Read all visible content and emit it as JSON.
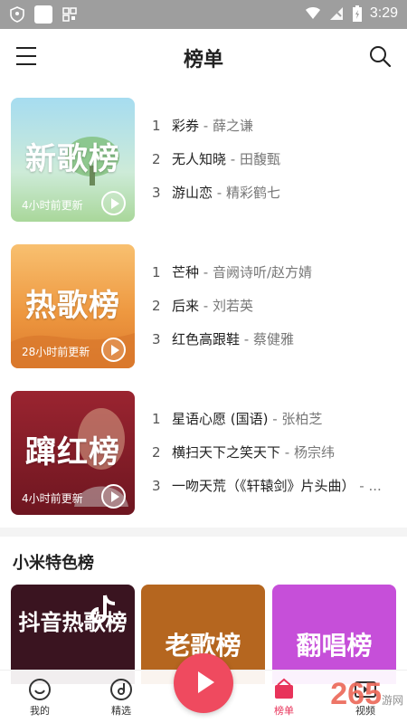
{
  "status_bar": {
    "time": "3:29"
  },
  "header": {
    "title": "榜单"
  },
  "ranks": [
    {
      "cover_title": "新歌榜",
      "update_text": "4小时前更新",
      "colors": {
        "top": "#9fd6e8",
        "bottom": "#b9e3c8"
      },
      "songs": [
        {
          "num": "1",
          "name": "彩券",
          "artist": " - 薛之谦"
        },
        {
          "num": "2",
          "name": "无人知晓",
          "artist": " - 田馥甄"
        },
        {
          "num": "3",
          "name": "游山恋",
          "artist": " - 精彩鹤七"
        }
      ]
    },
    {
      "cover_title": "热歌榜",
      "update_text": "28小时前更新",
      "colors": {
        "top": "#f6b15d",
        "bottom": "#e8873a"
      },
      "songs": [
        {
          "num": "1",
          "name": "芒种",
          "artist": " - 音阙诗听/赵方婧"
        },
        {
          "num": "2",
          "name": "后来",
          "artist": " - 刘若英"
        },
        {
          "num": "3",
          "name": "红色高跟鞋",
          "artist": " - 蔡健雅"
        }
      ]
    },
    {
      "cover_title": "蹿红榜",
      "update_text": "4小时前更新",
      "colors": {
        "top": "#8f1f2a",
        "bottom": "#5a0f18"
      },
      "songs": [
        {
          "num": "1",
          "name": "星语心愿 (国语)",
          "artist": " - 张柏芝"
        },
        {
          "num": "2",
          "name": "横扫天下之笑天下",
          "artist": " - 杨宗纬"
        },
        {
          "num": "3",
          "name": "一吻天荒（《轩辕剑》片头曲）",
          "artist": " - ..."
        }
      ]
    }
  ],
  "featured": {
    "section_title": "小米特色榜",
    "items": [
      {
        "title": "抖音热歌榜",
        "color": "#3a1420"
      },
      {
        "title": "老歌榜",
        "color": "#b5661f"
      },
      {
        "title": "翻唱榜",
        "color": "#c64fd9"
      }
    ]
  },
  "bottom_nav": {
    "items": [
      {
        "label": "我的"
      },
      {
        "label": "精选"
      },
      {
        "label": "榜单"
      },
      {
        "label": "视频"
      }
    ],
    "active_color": "#e8335a"
  },
  "watermark": {
    "text": "265",
    "sub": "游网"
  }
}
